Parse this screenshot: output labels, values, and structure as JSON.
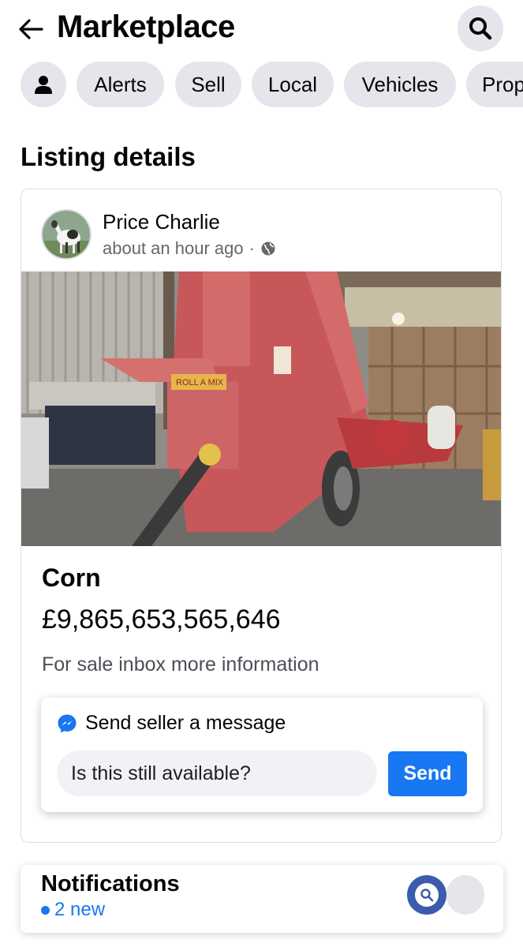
{
  "header": {
    "title": "Marketplace"
  },
  "chips": [
    {
      "label": "Alerts"
    },
    {
      "label": "Sell"
    },
    {
      "label": "Local"
    },
    {
      "label": "Vehicles"
    },
    {
      "label": "Prop"
    }
  ],
  "section_title": "Listing details",
  "listing": {
    "seller_name": "Price Charlie",
    "posted_time": "about an hour ago",
    "separator": "·",
    "photo_sign_text": "ROLL A MIX",
    "title": "Corn",
    "price": "£9,865,653,565,646",
    "description": "For sale inbox more information"
  },
  "message": {
    "heading": "Send seller a message",
    "input_value": "Is this still available?",
    "send_label": "Send"
  },
  "notifications": {
    "title": "Notifications",
    "new_count": "2 new"
  },
  "icons": {
    "back": "arrow-left-icon",
    "search": "search-icon",
    "profile": "person-icon",
    "globe": "globe-icon",
    "messenger": "messenger-icon"
  },
  "colors": {
    "accent": "#1877f2",
    "chip_bg": "#e4e6eb",
    "secondary_text": "#65676b"
  }
}
